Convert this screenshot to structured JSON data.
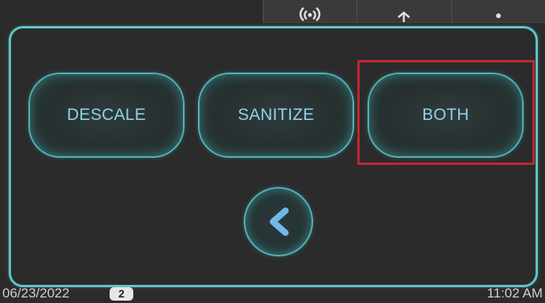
{
  "header": {
    "icons": [
      "wireless-signal-icon",
      "bluetooth-icon",
      "menu-dots-icon"
    ]
  },
  "options": {
    "descale_label": "DESCALE",
    "sanitize_label": "SANITIZE",
    "both_label": "BOTH"
  },
  "back_icon": "chevron-left-icon",
  "footer": {
    "date": "06/23/2022",
    "badge": "2",
    "time": "11:02 AM"
  },
  "colors": {
    "accent": "#5fc4c8",
    "button_text": "#8fd3ea",
    "back_chevron": "#6fb9ea",
    "highlight": "#c0272d",
    "background": "#2b2b2b"
  }
}
